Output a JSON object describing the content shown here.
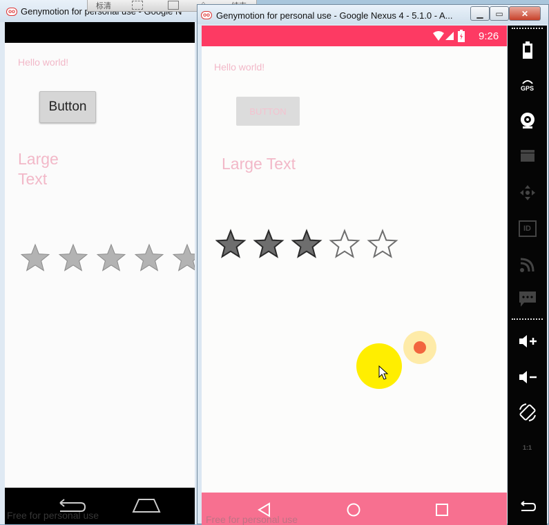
{
  "back_window": {
    "title": "Genymotion for personal use - Google N",
    "hello": "Hello world!",
    "button": "Button",
    "large_text_line1": "Large",
    "large_text_line2": "Text",
    "watermark": "Free for personal use"
  },
  "floating_toolbar": {
    "label1": "标清",
    "label2": "结束"
  },
  "front_window": {
    "title": "Genymotion for personal use - Google Nexus 4 - 5.1.0 - A...",
    "status_time": "9:26",
    "hello": "Hello world!",
    "button": "BUTTON",
    "large_text": "Large Text",
    "rating": {
      "filled": 3,
      "total": 5
    },
    "watermark": "Free for personal use",
    "side_labels": {
      "gps": "GPS",
      "id": "ID",
      "scale": "1:1"
    }
  },
  "colors": {
    "status_bar": "#fd3a63",
    "nav_bar": "#f77090",
    "text_pink": "#f2b8c8",
    "click_circle": "#ffee00"
  }
}
